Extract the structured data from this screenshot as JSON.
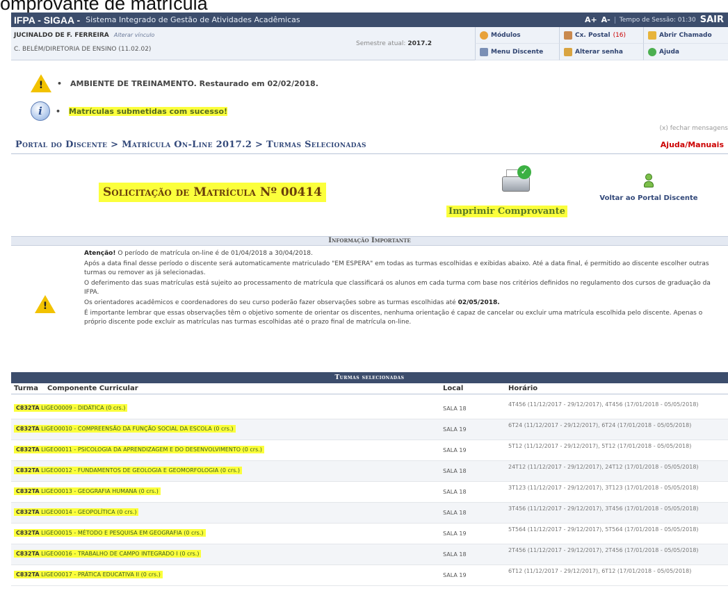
{
  "caption": "omprovante de matrícula",
  "topbar": {
    "system": "IFPA - SIGAA -",
    "system_desc": "Sistema Integrado de Gestão de Atividades Acadêmicas",
    "font_up": "A+",
    "font_down": "A-",
    "session_time": "Tempo de Sessão: 01:30",
    "logout": "SAIR"
  },
  "user": {
    "name": "JUCINALDO DE F. FERREIRA",
    "alter_link": "Alterar vínculo",
    "unit": "C. BELÉM/DIRETORIA DE ENSINO (11.02.02)",
    "semester_label": "Semestre atual:",
    "semester_value": "2017.2"
  },
  "menu": {
    "modulos": "Módulos",
    "cx_postal": "Cx. Postal",
    "cx_postal_count": "(16)",
    "abrir_chamado": "Abrir Chamado",
    "menu_discente": "Menu Discente",
    "alterar_senha": "Alterar senha",
    "ajuda": "Ajuda"
  },
  "messages": {
    "training": "AMBIENTE DE TREINAMENTO. Restaurado em 02/02/2018.",
    "success": "Matrículas submetidas com sucesso!",
    "close": "(x) fechar mensagens"
  },
  "breadcrumb": "Portal do Discente > Matrícula On-Line 2017.2 > Turmas Selecionadas",
  "help": "Ajuda/Manuais",
  "solicitation_title": "Solicitação de Matrícula Nº 00414",
  "actions": {
    "print": "Imprimir Comprovante",
    "back": "Voltar ao Portal Discente"
  },
  "info": {
    "header": "Informação Importante",
    "attention_label": "Atenção!",
    "p1": " O período de matrícula on-line é de 01/04/2018 a 30/04/2018.",
    "p2": "Após a data final desse período o discente será automaticamente matriculado \"EM ESPERA\" em todas as turmas escolhidas e exibidas abaixo. Até a data final, é permitido ao discente escolher outras turmas ou remover as já selecionadas.",
    "p3": "O deferimento das suas matrículas está sujeito ao processamento de matrícula que classificará os alunos em cada turma com base nos critérios definidos no regulamento dos cursos de graduação da IFPA.",
    "p4_pre": "Os orientadores acadêmicos e coordenadores do seu curso poderão fazer observações sobre as turmas escolhidas até ",
    "p4_date": "02/05/2018.",
    "p5": "É importante lembrar que essas observações têm o objetivo somente de orientar os discentes, nenhuma orientação é capaz de cancelar ou excluir uma matrícula escolhida pelo discente. Apenas o próprio discente pode excluir as matrículas nas turmas escolhidas até o prazo final de matrícula on-line."
  },
  "table": {
    "title": "Turmas selecionadas",
    "col_turma": "Turma",
    "col_componente": "Componente Curricular",
    "col_local": "Local",
    "col_horario": "Horário",
    "rows": [
      {
        "turma": "C832TA",
        "componente": "LIGEO0009 - DIDÁTICA (0 crs.)",
        "local": "SALA 18",
        "horario": "4T456 (11/12/2017 - 29/12/2017), 4T456 (17/01/2018 - 05/05/2018)"
      },
      {
        "turma": "C832TA",
        "componente": "LIGEO0010 - COMPREENSÃO DA FUNÇÃO SOCIAL DA ESCOLA (0 crs.)",
        "local": "SALA 19",
        "horario": "6T24 (11/12/2017 - 29/12/2017), 6T24 (17/01/2018 - 05/05/2018)"
      },
      {
        "turma": "C832TA",
        "componente": "LIGEO0011 - PSICOLOGIA DA APRENDIZAGEM E DO DESENVOLVIMENTO (0 crs.)",
        "local": "SALA 19",
        "horario": "5T12 (11/12/2017 - 29/12/2017), 5T12 (17/01/2018 - 05/05/2018)"
      },
      {
        "turma": "C832TA",
        "componente": "LIGEO0012 - FUNDAMENTOS DE GEOLOGIA E GEOMORFOLOGIA (0 crs.)",
        "local": "SALA 18",
        "horario": "24T12 (11/12/2017 - 29/12/2017), 24T12 (17/01/2018 - 05/05/2018)"
      },
      {
        "turma": "C832TA",
        "componente": "LIGEO0013 - GEOGRAFIA HUMANA (0 crs.)",
        "local": "SALA 18",
        "horario": "3T123 (11/12/2017 - 29/12/2017), 3T123 (17/01/2018 - 05/05/2018)"
      },
      {
        "turma": "C832TA",
        "componente": "LIGEO0014 - GEOPOLÍTICA (0 crs.)",
        "local": "SALA 18",
        "horario": "3T456 (11/12/2017 - 29/12/2017), 3T456 (17/01/2018 - 05/05/2018)"
      },
      {
        "turma": "C832TA",
        "componente": "LIGEO0015 - MÉTODO E PESQUISA EM GEOGRAFIA (0 crs.)",
        "local": "SALA 19",
        "horario": "5T564 (11/12/2017 - 29/12/2017), 5T564 (17/01/2018 - 05/05/2018)"
      },
      {
        "turma": "C832TA",
        "componente": "LIGEO0016 - TRABALHO DE CAMPO INTEGRADO I (0 crs.)",
        "local": "SALA 18",
        "horario": "2T456 (11/12/2017 - 29/12/2017), 2T456 (17/01/2018 - 05/05/2018)"
      },
      {
        "turma": "C832TA",
        "componente": "LIGEO0017 - PRÁTICA EDUCATIVA II (0 crs.)",
        "local": "SALA 19",
        "horario": "6T12 (11/12/2017 - 29/12/2017), 6T12 (17/01/2018 - 05/05/2018)"
      }
    ]
  },
  "colors": {
    "header_bg": "#3c4d6c",
    "highlight": "#fbff3c",
    "link_blue": "#33497a",
    "help_red": "#cc0000"
  },
  "icons": {
    "warning": "warning-triangle-icon",
    "info": "info-icon",
    "printer": "printer-check-icon",
    "portal": "user-icon"
  }
}
